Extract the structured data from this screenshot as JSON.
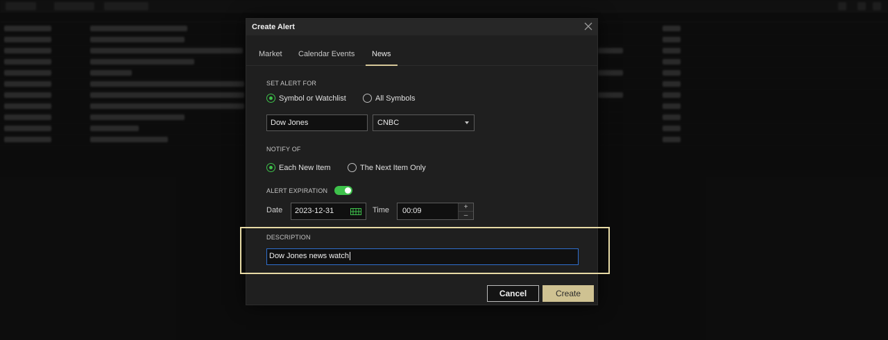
{
  "dialog": {
    "title": "Create Alert",
    "tabs": [
      {
        "label": "Market",
        "active": false
      },
      {
        "label": "Calendar Events",
        "active": false
      },
      {
        "label": "News",
        "active": true
      }
    ],
    "set_alert_for": {
      "label": "SET ALERT FOR",
      "options": [
        {
          "label": "Symbol or Watchlist",
          "checked": true
        },
        {
          "label": "All Symbols",
          "checked": false
        }
      ],
      "symbol_value": "Dow Jones",
      "source_value": "CNBC"
    },
    "notify_of": {
      "label": "NOTIFY OF",
      "options": [
        {
          "label": "Each New Item",
          "checked": true
        },
        {
          "label": "The Next Item Only",
          "checked": false
        }
      ]
    },
    "expiration": {
      "label": "ALERT EXPIRATION",
      "enabled": true,
      "date_label": "Date",
      "date_value": "2023-12-31",
      "time_label": "Time",
      "time_value": "00:09"
    },
    "description": {
      "label": "DESCRIPTION",
      "value": "Dow Jones news watch"
    },
    "buttons": {
      "cancel": "Cancel",
      "create": "Create"
    }
  },
  "colors": {
    "accent_gold": "#d7c89a",
    "toggle_green": "#3ec14b",
    "focus_blue": "#2f6fd0",
    "highlight_border": "#e8dba6"
  },
  "icons": [
    "close-icon",
    "chevron-down-icon",
    "calendar-icon",
    "plus-icon",
    "minus-icon"
  ]
}
